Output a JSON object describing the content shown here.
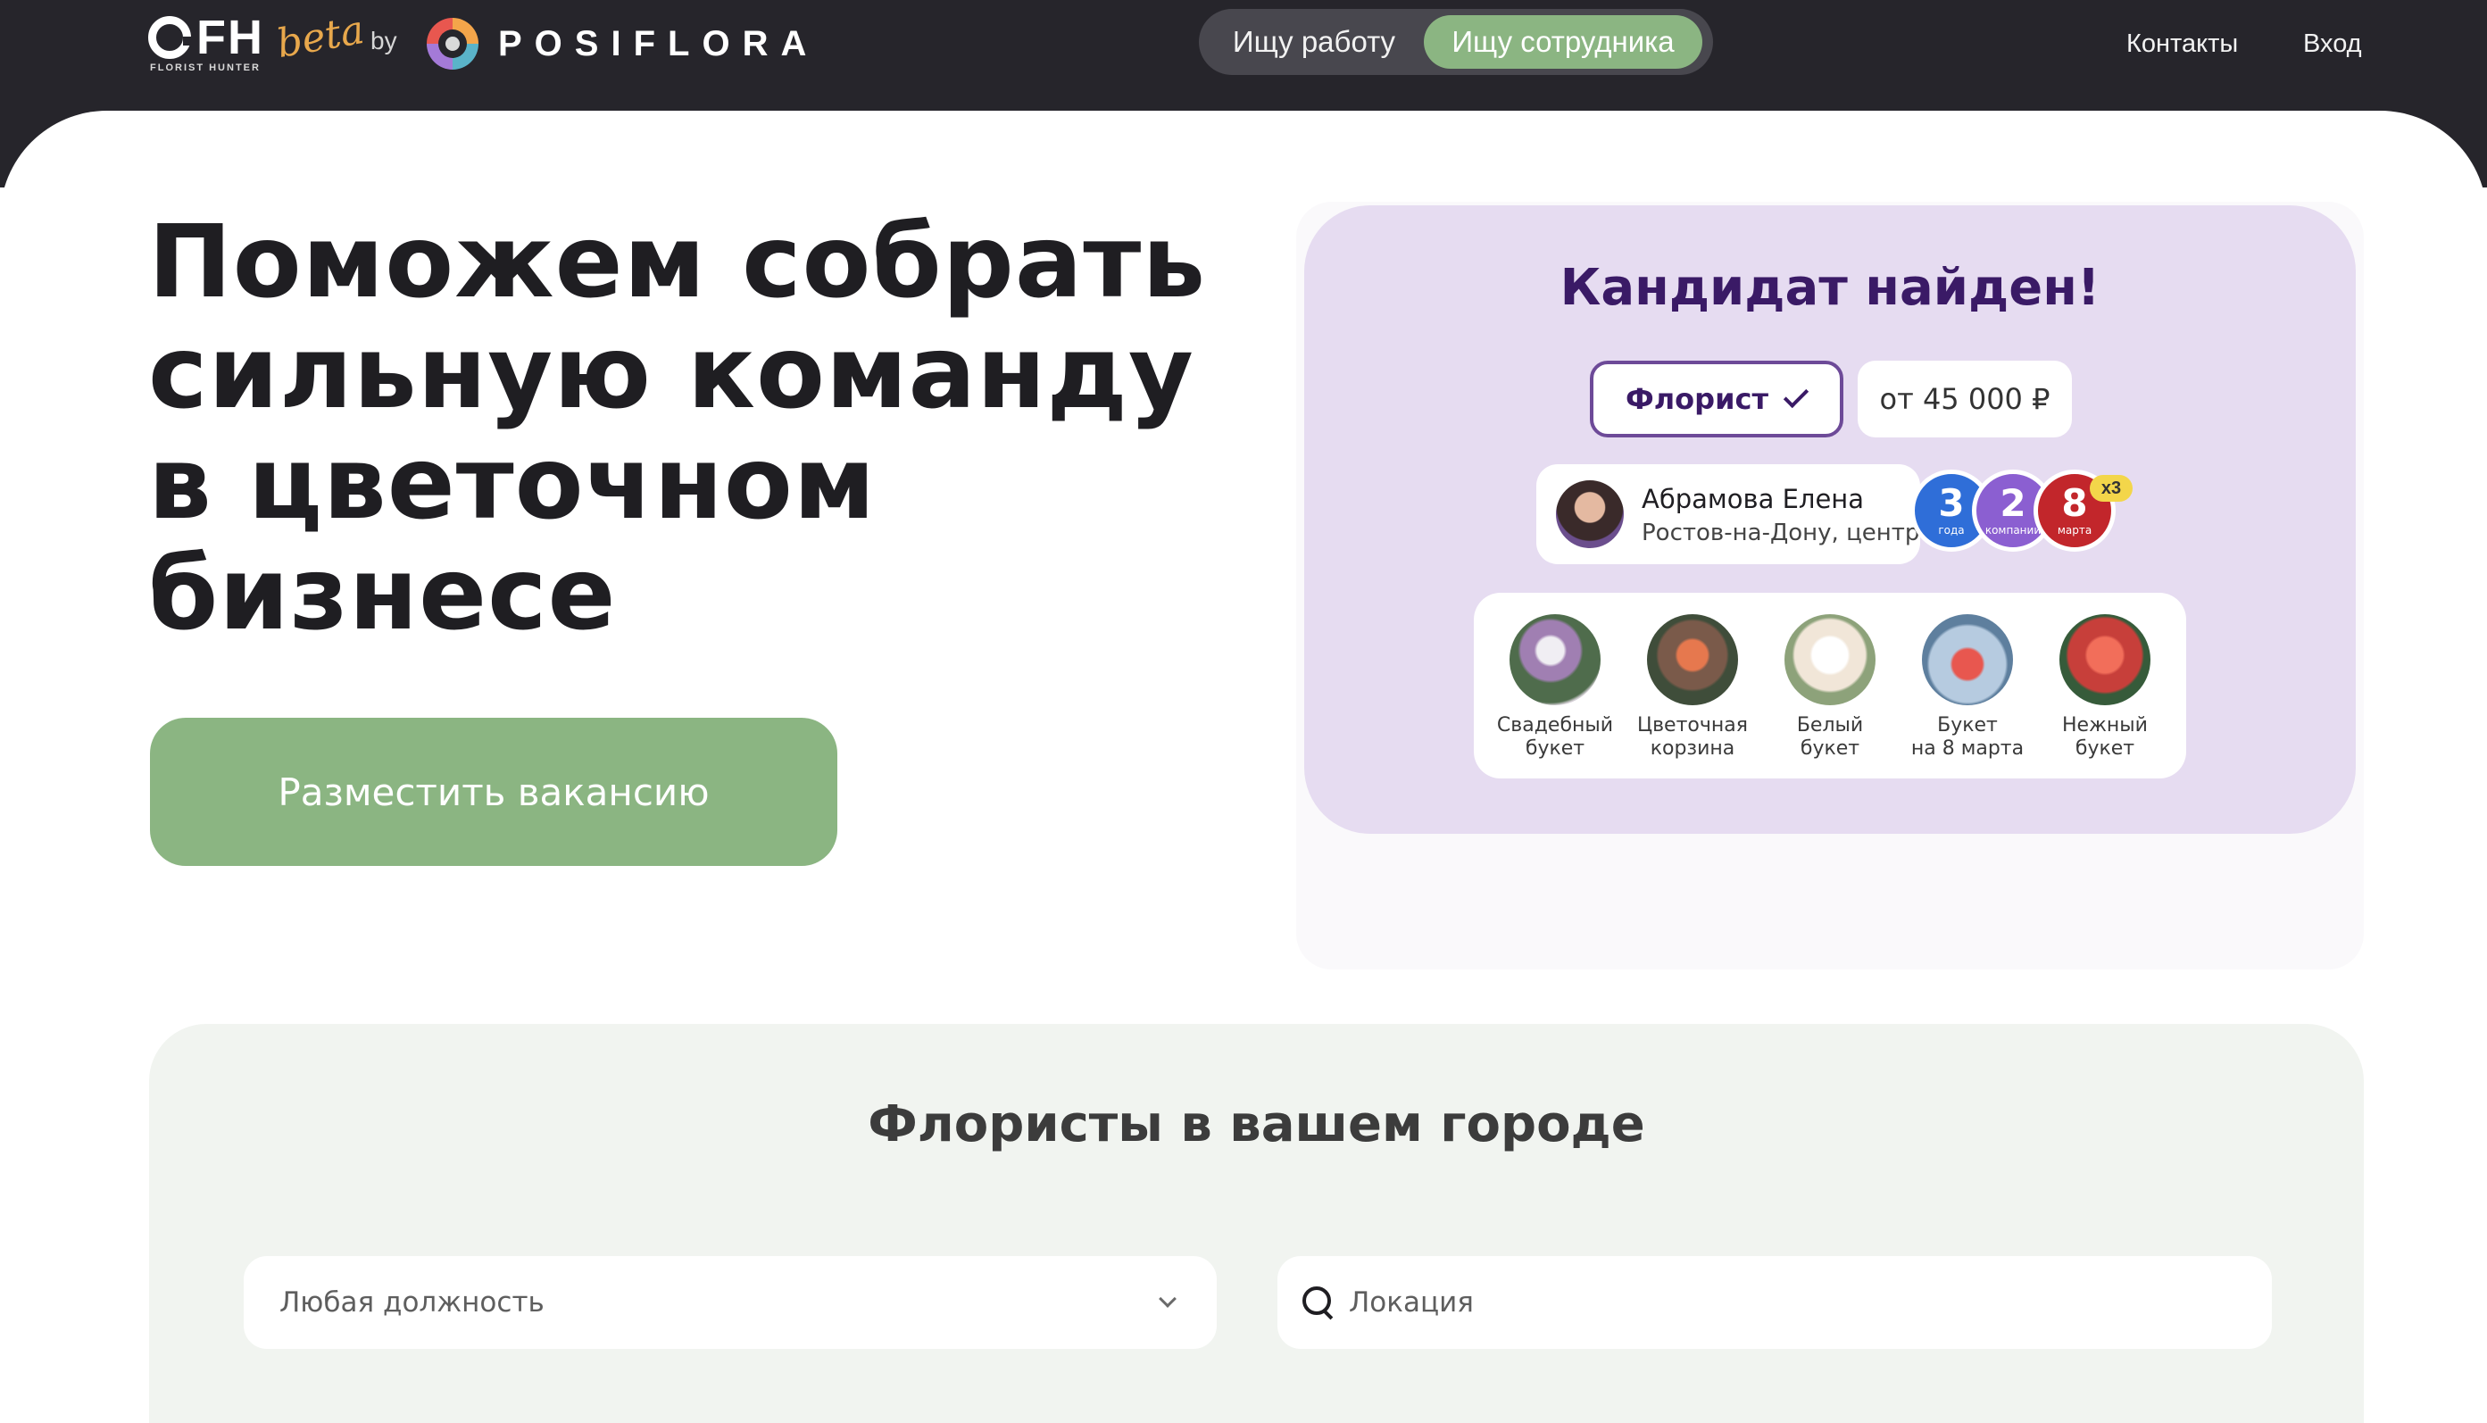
{
  "header": {
    "brand": {
      "mark": "FH",
      "subtitle": "FLORIST HUNTER",
      "beta": "beta",
      "by": "by",
      "partner": "POSIFLORA"
    },
    "toggle": {
      "job_seeker": "Ищу работу",
      "employer": "Ищу сотрудника",
      "active": "employer"
    },
    "nav": {
      "contacts": "Контакты",
      "login": "Вход"
    }
  },
  "hero": {
    "title_lines": [
      "Поможем собрать",
      "сильную команду",
      "в цветочном",
      "бизнесе"
    ],
    "cta": "Разместить вакансию"
  },
  "candidate_card": {
    "title": "Кандидат найден!",
    "role": "Флорист",
    "salary": "от 45 000 ₽",
    "person": {
      "name": "Абрамова Елена",
      "city": "Ростов-на-Дону, центр"
    },
    "badges": [
      {
        "num": "3",
        "label": "года"
      },
      {
        "num": "2",
        "label": "компании"
      },
      {
        "num": "8",
        "label": "марта"
      }
    ],
    "badge_multiplier": "x3",
    "portfolio": [
      {
        "line1": "Свадебный",
        "line2": "букет"
      },
      {
        "line1": "Цветочная",
        "line2": "корзина"
      },
      {
        "line1": "Белый",
        "line2": "букет"
      },
      {
        "line1": "Букет",
        "line2": "на 8 марта"
      },
      {
        "line1": "Нежный",
        "line2": "букет"
      }
    ]
  },
  "florists": {
    "title": "Флористы в вашем городе",
    "position_select": "Любая должность",
    "location_placeholder": "Локация"
  },
  "colors": {
    "header_bg": "#26252b",
    "accent_green": "#8bb582",
    "card_lavender": "#e6dcf1",
    "card_title": "#3a1a66",
    "section_bg": "#f1f4f0"
  }
}
